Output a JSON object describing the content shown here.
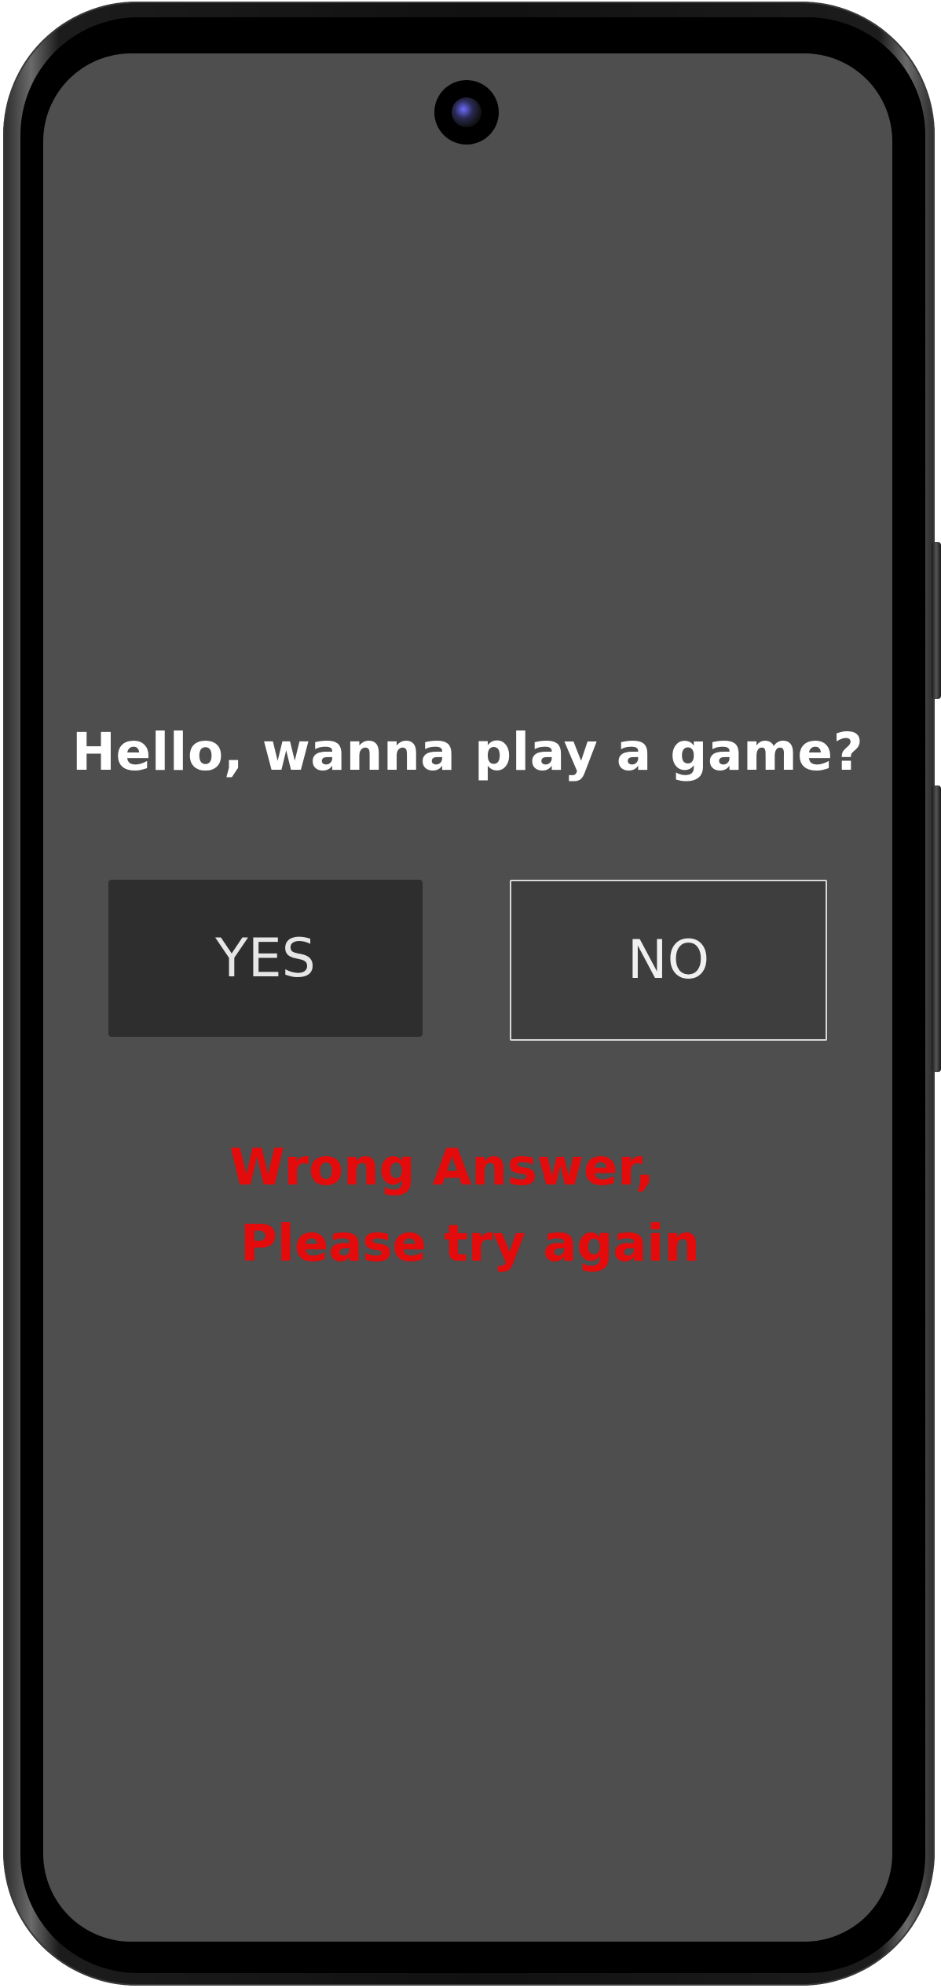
{
  "screen": {
    "question": "Hello, wanna play a game?",
    "yes_label": "YES",
    "no_label": "NO",
    "error_line1": "Wrong Answer,",
    "error_line2": "Please try again"
  },
  "colors": {
    "screen_bg": "#4e4e4e",
    "yes_button_bg": "#2e2e2e",
    "no_button_bg": "#3e3e3e",
    "error_text": "#e30b0b"
  }
}
